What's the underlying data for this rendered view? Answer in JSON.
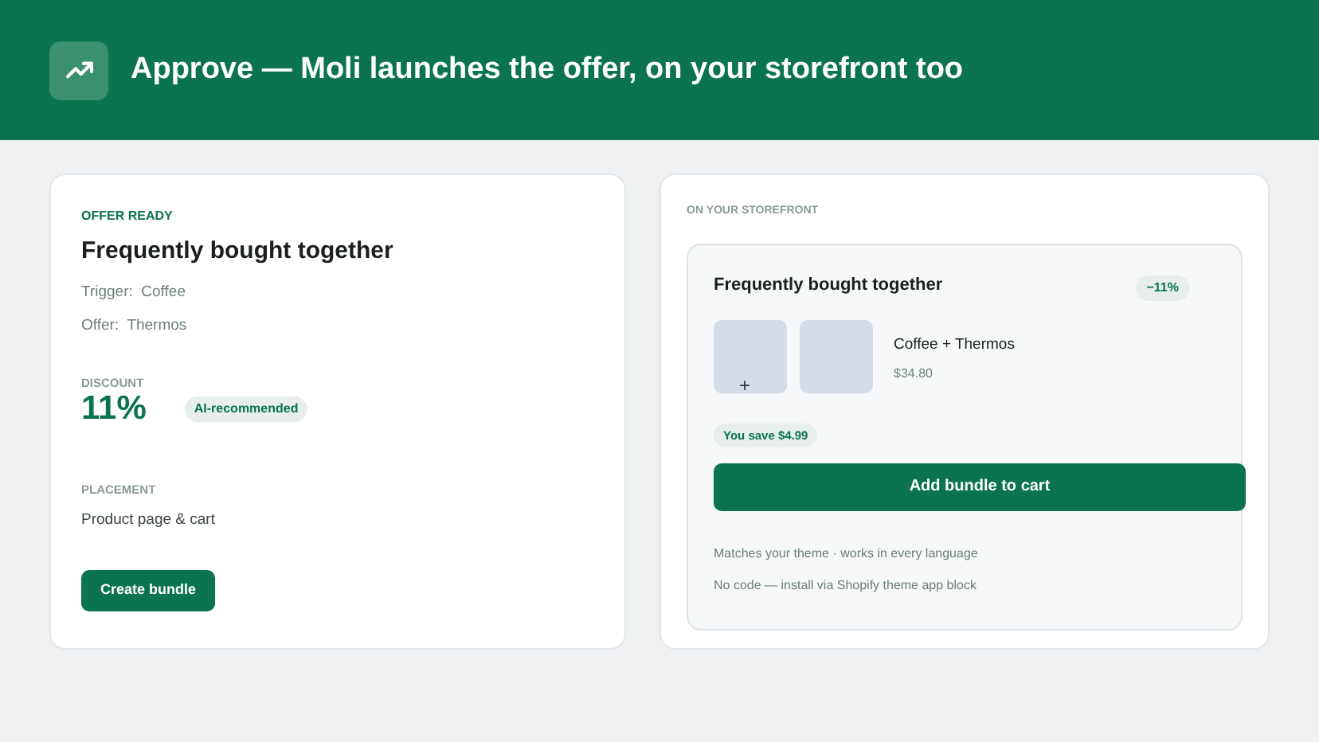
{
  "header": {
    "title": "Approve — Moli launches the offer, on your storefront too"
  },
  "offer": {
    "eyebrow": "OFFER READY",
    "title": "Frequently bought together",
    "details": [
      {
        "label": "Trigger:",
        "value": "Coffee"
      },
      {
        "label": "Offer:",
        "value": "Thermos"
      }
    ],
    "discount_label": "DISCOUNT",
    "discount": "11%",
    "badge": "AI-recommended",
    "placement_label": "PLACEMENT",
    "placement": "Product page & cart",
    "button": "Create bundle"
  },
  "storefront": {
    "eyebrow": "ON YOUR STOREFRONT",
    "title": "Frequently bought together",
    "badge": "−11%",
    "plus": "+",
    "product": "Coffee + Thermos",
    "price": "$34.80",
    "savings": "You save $4.99",
    "button": "Add bundle to cart",
    "notes": [
      "Matches your theme · works in every language",
      "No code — install via Shopify theme app block"
    ]
  }
}
